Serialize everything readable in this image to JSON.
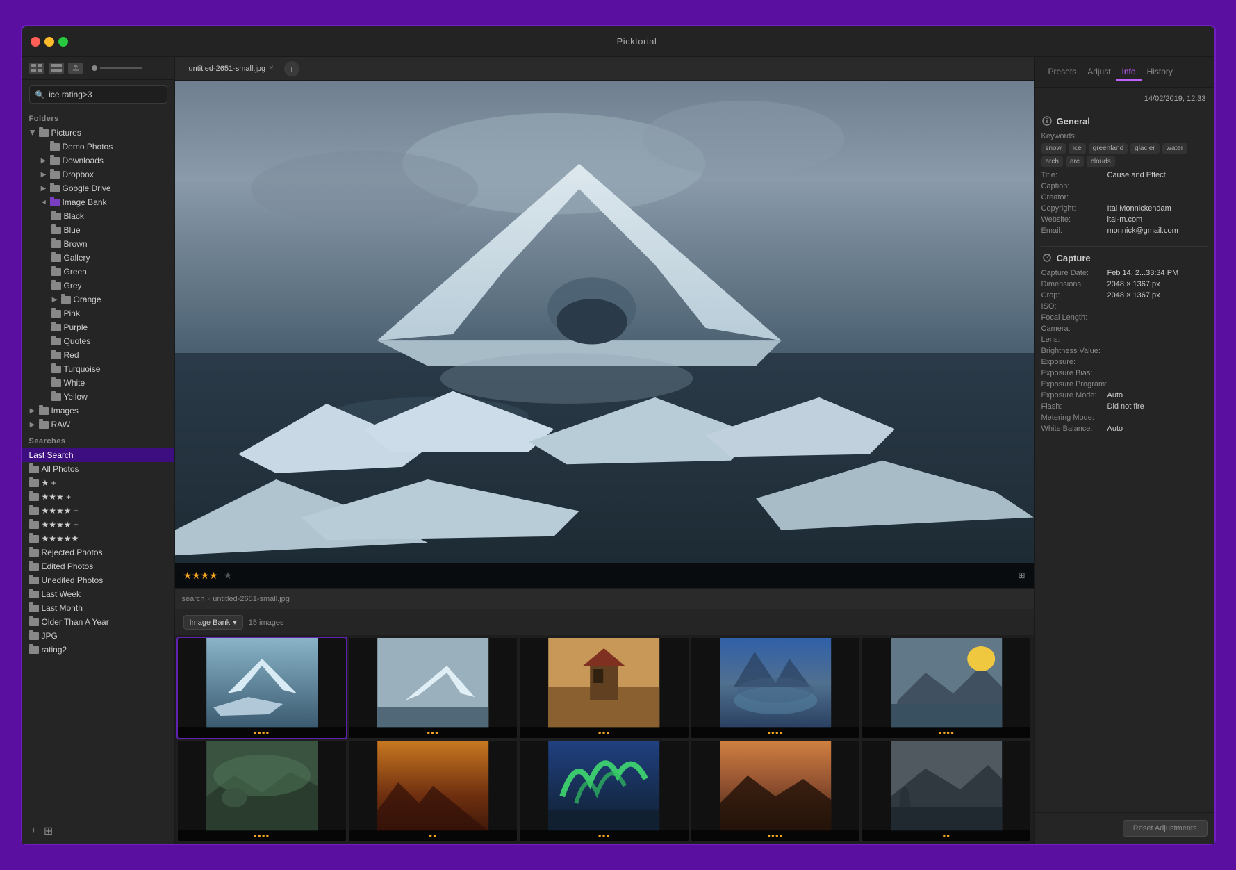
{
  "app": {
    "title": "Picktorial",
    "datetime": "14/02/2019, 12:33"
  },
  "toolbar": {
    "search_placeholder": "ice rating>3"
  },
  "sidebar": {
    "folders_label": "Folders",
    "searches_label": "Searches",
    "folders": [
      {
        "id": "pictures",
        "label": "Pictures",
        "level": 0,
        "hasArrow": true,
        "expanded": true
      },
      {
        "id": "demo-photos",
        "label": "Demo Photos",
        "level": 1,
        "hasArrow": false
      },
      {
        "id": "downloads",
        "label": "Downloads",
        "level": 1,
        "hasArrow": true
      },
      {
        "id": "dropbox",
        "label": "Dropbox",
        "level": 1,
        "hasArrow": true
      },
      {
        "id": "google-drive",
        "label": "Google Drive",
        "level": 1,
        "hasArrow": true
      },
      {
        "id": "image-bank",
        "label": "Image Bank",
        "level": 1,
        "hasArrow": true,
        "expanded": true
      },
      {
        "id": "black",
        "label": "Black",
        "level": 2,
        "hasArrow": false
      },
      {
        "id": "blue",
        "label": "Blue",
        "level": 2,
        "hasArrow": false
      },
      {
        "id": "brown",
        "label": "Brown",
        "level": 2,
        "hasArrow": false
      },
      {
        "id": "gallery",
        "label": "Gallery",
        "level": 2,
        "hasArrow": false
      },
      {
        "id": "green",
        "label": "Green",
        "level": 2,
        "hasArrow": false
      },
      {
        "id": "grey",
        "label": "Grey",
        "level": 2,
        "hasArrow": false
      },
      {
        "id": "orange",
        "label": "Orange",
        "level": 2,
        "hasArrow": true
      },
      {
        "id": "pink",
        "label": "Pink",
        "level": 2,
        "hasArrow": false
      },
      {
        "id": "purple",
        "label": "Purple",
        "level": 2,
        "hasArrow": false
      },
      {
        "id": "quotes",
        "label": "Quotes",
        "level": 2,
        "hasArrow": false
      },
      {
        "id": "red",
        "label": "Red",
        "level": 2,
        "hasArrow": false
      },
      {
        "id": "turquoise",
        "label": "Turquoise",
        "level": 2,
        "hasArrow": false
      },
      {
        "id": "white",
        "label": "White",
        "level": 2,
        "hasArrow": false
      },
      {
        "id": "yellow",
        "label": "Yellow",
        "level": 2,
        "hasArrow": false
      },
      {
        "id": "images",
        "label": "Images",
        "level": 0,
        "hasArrow": true
      },
      {
        "id": "raw",
        "label": "RAW",
        "level": 0,
        "hasArrow": true
      }
    ],
    "searches": [
      {
        "id": "last-search",
        "label": "Last Search",
        "level": 0,
        "active": true
      },
      {
        "id": "all-photos",
        "label": "All Photos",
        "level": 0
      },
      {
        "id": "star2",
        "label": "★ +",
        "level": 0
      },
      {
        "id": "star3",
        "label": "★★★ +",
        "level": 0
      },
      {
        "id": "star4p",
        "label": "★★★★ +",
        "level": 0
      },
      {
        "id": "star4",
        "label": "★★★★ +",
        "level": 0
      },
      {
        "id": "star5",
        "label": "★★★★★",
        "level": 0
      },
      {
        "id": "rejected",
        "label": "Rejected Photos",
        "level": 0
      },
      {
        "id": "edited",
        "label": "Edited Photos",
        "level": 0
      },
      {
        "id": "unedited",
        "label": "Unedited Photos",
        "level": 0
      },
      {
        "id": "last-week",
        "label": "Last Week",
        "level": 0
      },
      {
        "id": "last-month",
        "label": "Last Month",
        "level": 0
      },
      {
        "id": "older",
        "label": "Older Than A Year",
        "level": 0
      },
      {
        "id": "jpg",
        "label": "JPG",
        "level": 0
      },
      {
        "id": "rating2",
        "label": "rating2",
        "level": 0
      }
    ],
    "add_label": "+",
    "grid_label": "⊞"
  },
  "image_tabs": [
    {
      "id": "tab1",
      "label": "untitled-2651-small.jpg",
      "active": true
    }
  ],
  "tab_add": "+",
  "main_image": {
    "alt": "Iceberg photo",
    "stars_filled": 4,
    "stars_empty": 1
  },
  "breadcrumb": {
    "path": [
      "search",
      "untitled-2651-small.jpg"
    ]
  },
  "bottom_toolbar": {
    "bank_label": "Image Bank",
    "count_label": "15 images"
  },
  "thumbnails": [
    {
      "id": "t1",
      "selected": true,
      "stars": "●●●●",
      "color": "#8ab4c8"
    },
    {
      "id": "t2",
      "selected": false,
      "stars": "●●●",
      "color": "#b8cfd8"
    },
    {
      "id": "t3",
      "selected": false,
      "stars": "●●●",
      "color": "#c8a870"
    },
    {
      "id": "t4",
      "selected": false,
      "stars": "●●●●",
      "color": "#4a6888"
    },
    {
      "id": "t5",
      "selected": false,
      "stars": "●●●●",
      "color": "#7090a0"
    },
    {
      "id": "t6",
      "selected": false,
      "stars": "●●●●",
      "color": "#5a7060"
    },
    {
      "id": "t7",
      "selected": false,
      "stars": "●●",
      "color": "#404040"
    },
    {
      "id": "t8",
      "selected": false,
      "stars": "●●●",
      "color": "#60a870"
    },
    {
      "id": "t9",
      "selected": false,
      "stars": "●●●●",
      "color": "#8080a0"
    },
    {
      "id": "t10",
      "selected": false,
      "stars": "●●",
      "color": "#606870"
    }
  ],
  "right_panel": {
    "tabs": [
      "Presets",
      "Adjust",
      "Info",
      "History"
    ],
    "active_tab": "Info",
    "datetime": "14/02/2019, 12:33",
    "general": {
      "title": "General",
      "keywords_label": "Keywords:",
      "keywords": [
        "snow",
        "ice",
        "greenland",
        "glacier",
        "water",
        "arch",
        "arc",
        "clouds"
      ],
      "fields": [
        {
          "label": "Title:",
          "value": "Cause and  Effect"
        },
        {
          "label": "Caption:",
          "value": ""
        },
        {
          "label": "Creator:",
          "value": ""
        },
        {
          "label": "Copyright:",
          "value": "Itai Monnickendam"
        },
        {
          "label": "Website:",
          "value": "itai-m.com"
        },
        {
          "label": "Email:",
          "value": "monnick@gmail.com"
        }
      ]
    },
    "capture": {
      "title": "Capture",
      "fields": [
        {
          "label": "Capture Date:",
          "value": "Feb 14, 2...33:34 PM"
        },
        {
          "label": "Dimensions:",
          "value": "2048 × 1367 px"
        },
        {
          "label": "Crop:",
          "value": "2048 × 1367 px"
        },
        {
          "label": "ISO:",
          "value": ""
        },
        {
          "label": "Focal Length:",
          "value": ""
        },
        {
          "label": "Camera:",
          "value": ""
        },
        {
          "label": "Lens:",
          "value": ""
        },
        {
          "label": "Brightness Value:",
          "value": ""
        },
        {
          "label": "Exposure:",
          "value": ""
        },
        {
          "label": "Exposure Bias:",
          "value": ""
        },
        {
          "label": "Exposure Program:",
          "value": ""
        },
        {
          "label": "Exposure Mode:",
          "value": "Auto"
        },
        {
          "label": "Flash:",
          "value": "Did not fire"
        },
        {
          "label": "Metering Mode:",
          "value": ""
        },
        {
          "label": "White Balance:",
          "value": "Auto"
        }
      ]
    },
    "reset_label": "Reset Adjustments"
  }
}
